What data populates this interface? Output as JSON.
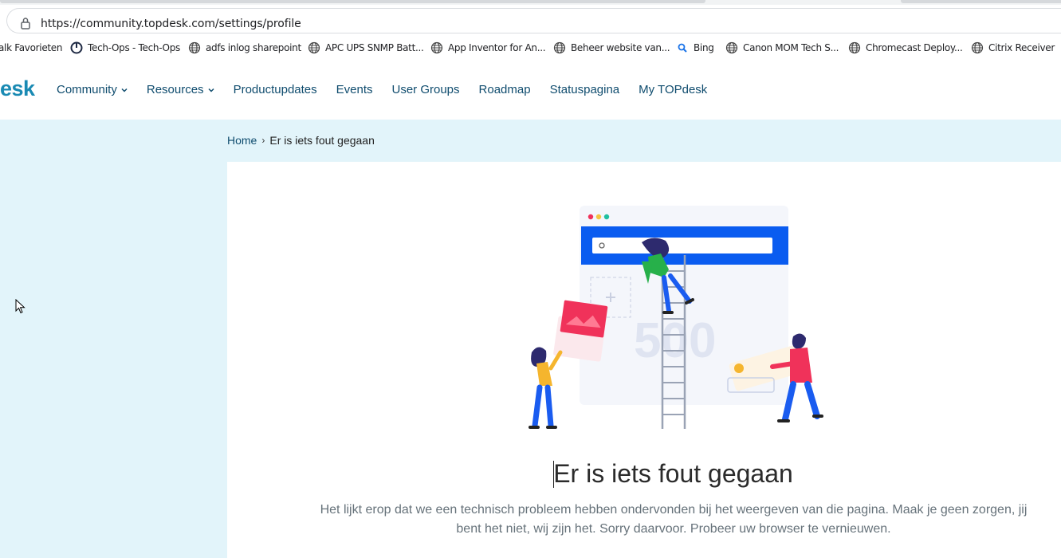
{
  "browser": {
    "url": "https://community.topdesk.com/settings/profile",
    "bookmarks": [
      {
        "label": "alk Favorieten",
        "icon": "none"
      },
      {
        "label": "Tech-Ops - Tech-Ops",
        "icon": "power-icon"
      },
      {
        "label": "adfs inlog sharepoint",
        "icon": "globe-icon"
      },
      {
        "label": "APC UPS SNMP Batt...",
        "icon": "globe-icon"
      },
      {
        "label": "App Inventor for An...",
        "icon": "globe-icon"
      },
      {
        "label": "Beheer website van...",
        "icon": "globe-icon"
      },
      {
        "label": "Bing",
        "icon": "bing-search-icon"
      },
      {
        "label": "Canon MOM Tech S...",
        "icon": "globe-icon"
      },
      {
        "label": "Chromecast Deploy...",
        "icon": "globe-icon"
      },
      {
        "label": "Citrix Receiver",
        "icon": "globe-icon"
      }
    ]
  },
  "header": {
    "logo_text": "esk",
    "nav": [
      {
        "label": "Community",
        "has_dropdown": true
      },
      {
        "label": "Resources",
        "has_dropdown": true
      },
      {
        "label": "Productupdates",
        "has_dropdown": false
      },
      {
        "label": "Events",
        "has_dropdown": false
      },
      {
        "label": "User Groups",
        "has_dropdown": false
      },
      {
        "label": "Roadmap",
        "has_dropdown": false
      },
      {
        "label": "Statuspagina",
        "has_dropdown": false
      },
      {
        "label": "My TOPdesk",
        "has_dropdown": false
      }
    ]
  },
  "breadcrumb": {
    "home": "Home",
    "separator": "›",
    "current": "Er is iets fout gegaan"
  },
  "error": {
    "illustration_code": "500",
    "title": "Er is iets fout gegaan",
    "message": "Het lijkt erop dat we een technisch probleem hebben ondervonden bij het weergeven van die pagina. Maak je geen zorgen, jij bent het niet, wij zijn het. Sorry daarvoor. Probeer uw browser te vernieuwen."
  },
  "colors": {
    "brand": "#1a8ab3",
    "nav_text": "#0f4c6e",
    "page_background": "#e2f4fa",
    "illustration_blue": "#0a5cf0",
    "illustration_red": "#f0325a"
  }
}
